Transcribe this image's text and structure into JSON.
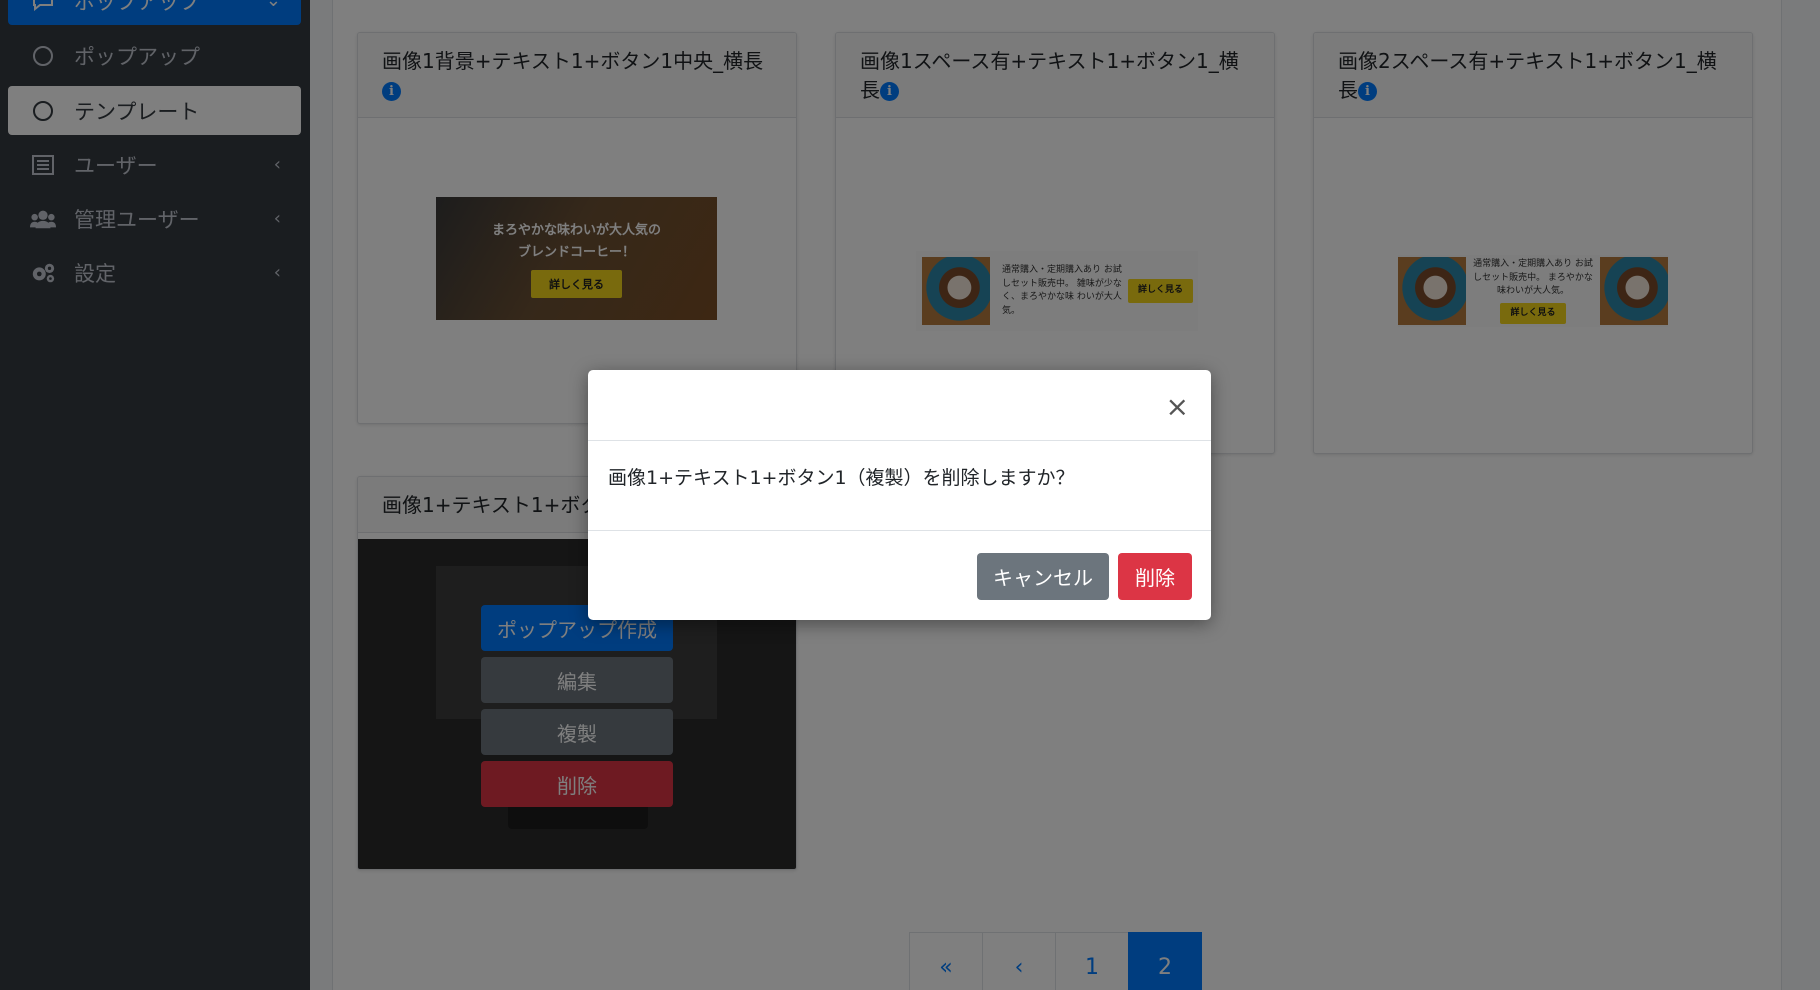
{
  "sidebar": {
    "parent_label": "ポップアップ",
    "items": [
      {
        "label": "ポップアップ"
      },
      {
        "label": "テンプレート"
      },
      {
        "label": "ユーザー"
      },
      {
        "label": "管理ユーザー"
      },
      {
        "label": "設定"
      }
    ]
  },
  "templates": [
    {
      "title": "画像1背景+テキスト1+ボタン1中央_横長",
      "banner_line1": "まろやかな味わいが大人気の",
      "banner_line2": "ブレンドコーヒー！",
      "banner_button": "詳しく見る"
    },
    {
      "title": "画像1スペース有+テキスト1+ボタン1_横長",
      "banner_text": "通常購入・定期購入あり お試しセット販売中。 雑味が少なく、まろやかな味 わいが大人気。",
      "banner_button": "詳しく見る"
    },
    {
      "title": "画像2スペース有+テキスト1+ボタン1_横長",
      "banner_text": "通常購入・定期購入あり お試しセット販売中。 まろやかな味わいが大人気。",
      "banner_button": "詳しく見る"
    },
    {
      "title": "画像1+テキスト1+ボタン1（複製）",
      "title_visible": "画像1+テキスト1+ボタ"
    }
  ],
  "card_actions": {
    "create": "ポップアップ作成",
    "edit": "編集",
    "duplicate": "複製",
    "delete": "削除"
  },
  "pagination": {
    "first": "«",
    "prev": "‹",
    "pages": [
      "1",
      "2"
    ],
    "current": "2"
  },
  "modal": {
    "close": "×",
    "message": "画像1+テキスト1+ボタン1（複製）を削除しますか？",
    "cancel_label": "キャンセル",
    "delete_label": "削除"
  },
  "colors": {
    "primary": "#007bff",
    "secondary": "#6c757d",
    "danger": "#dc3545",
    "sidebar": "#343a40"
  }
}
